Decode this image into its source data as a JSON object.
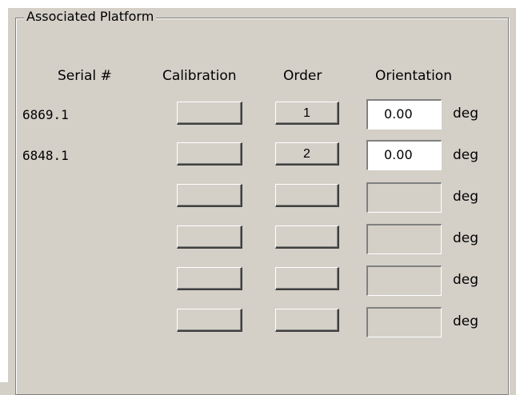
{
  "group": {
    "title": "Associated Platform"
  },
  "headers": {
    "serial": "Serial #",
    "calibration": "Calibration",
    "order": "Order",
    "orientation": "Orientation"
  },
  "rows": [
    {
      "serial": "6869.1",
      "calibration": "",
      "order": "1",
      "orientation": "0.00",
      "unit": "deg",
      "enabled": true
    },
    {
      "serial": "6848.1",
      "calibration": "",
      "order": "2",
      "orientation": "0.00",
      "unit": "deg",
      "enabled": true
    },
    {
      "serial": "",
      "calibration": "",
      "order": "",
      "orientation": "",
      "unit": "deg",
      "enabled": false
    },
    {
      "serial": "",
      "calibration": "",
      "order": "",
      "orientation": "",
      "unit": "deg",
      "enabled": false
    },
    {
      "serial": "",
      "calibration": "",
      "order": "",
      "orientation": "",
      "unit": "deg",
      "enabled": false
    },
    {
      "serial": "",
      "calibration": "",
      "order": "",
      "orientation": "",
      "unit": "deg",
      "enabled": false
    }
  ]
}
